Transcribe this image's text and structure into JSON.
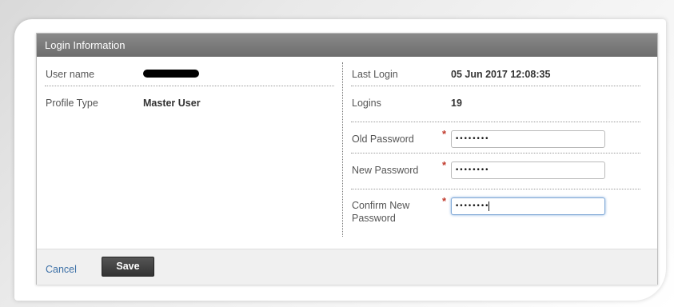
{
  "panel": {
    "title": "Login Information"
  },
  "left": {
    "username_label": "User name",
    "username_value": "",
    "profile_type_label": "Profile Type",
    "profile_type_value": "Master User"
  },
  "right": {
    "last_login_label": "Last Login",
    "last_login_value": "05 Jun 2017 12:08:35",
    "logins_label": "Logins",
    "logins_value": "19",
    "old_password_label": "Old Password",
    "old_password_value": "••••••••",
    "new_password_label": "New Password",
    "new_password_value": "••••••••",
    "confirm_password_label": "Confirm New Password",
    "confirm_password_value": "••••••••",
    "required_marker": "*"
  },
  "footer": {
    "cancel_label": "Cancel",
    "save_label": "Save"
  }
}
